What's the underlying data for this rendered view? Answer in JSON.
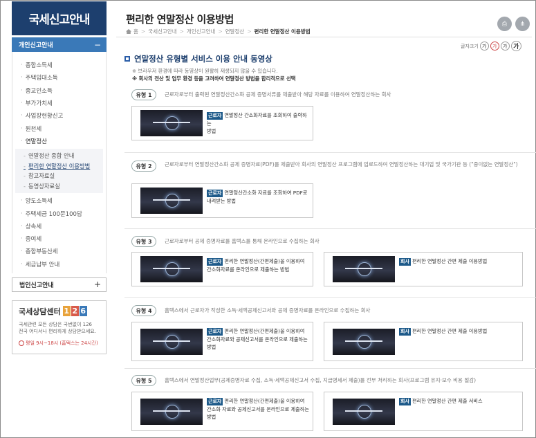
{
  "colors": {
    "brand": "#1d3f6e",
    "section": "#3a79b8",
    "tag": "#1d5a8a",
    "accent_red": "#c44"
  },
  "sidebar": {
    "title": "국세신고안내",
    "section_label": "개인신고안내",
    "section_toggle": "−",
    "items": [
      {
        "label": "종합소득세"
      },
      {
        "label": "주택임대소득"
      },
      {
        "label": "종교인소득"
      },
      {
        "label": "부가가치세"
      },
      {
        "label": "사업장현황신고"
      },
      {
        "label": "원천세"
      },
      {
        "label": "연말정산"
      }
    ],
    "sub_items": [
      {
        "label": "연말정산 종합 안내"
      },
      {
        "label": "편리한 연말정산 이용방법"
      },
      {
        "label": "참고자료실"
      },
      {
        "label": "동영상자료실"
      }
    ],
    "items_after": [
      {
        "label": "양도소득세"
      },
      {
        "label": "주택세금 100문100답"
      },
      {
        "label": "상속세"
      },
      {
        "label": "증여세"
      },
      {
        "label": "종합부동산세"
      },
      {
        "label": "세금납부 안내"
      }
    ],
    "corp_label": "법인신고안내",
    "corp_toggle": "+",
    "counsel": {
      "title": "국세상담센터",
      "digits": [
        "1",
        "2",
        "6"
      ],
      "digit_colors": [
        "#e8a23a",
        "#d85b4a",
        "#3a79b8"
      ],
      "desc1": "국세관련 모든 상담은 국번없이 126",
      "desc2": "전국 어디서나 편리하게 상담받으세요.",
      "time": "평일 9시~18시 (홈택스는 24시간)"
    }
  },
  "header": {
    "title": "편리한 연말정산 이용방법",
    "breadcrumb": [
      "국세신고안내",
      "개인신고안내",
      "연말정산",
      "편리한 연말정산 이용방법"
    ],
    "font_size_label": "글자크기",
    "font_buttons": [
      "가",
      "가",
      "가",
      "가"
    ]
  },
  "section": {
    "title": "연말정산 유형별 서비스 이용 안내 동영상",
    "note1": "※ 브라우저 환경에 따라 동영상이 원활히 재생되지 않을 수 있습니다.",
    "note2": "※ 회사의 전산 및 업무 환경 등을 고려하여 연말정산 방법을 합리적으로 선택"
  },
  "types": [
    {
      "label": "유형 1",
      "desc": "근로자로부터 출력된 연말정산간소화 공제 증명서류를 제출받아 해당 자료를 이용하여 연말정산하는 회사",
      "cards": [
        {
          "tag": "근로자",
          "line1": "연말정산 간소화자료를 조회하여 출력하는",
          "line2": "방법"
        }
      ]
    },
    {
      "label": "유형 2",
      "desc": "근로자로부터 연말정산간소화 공제 증명자료(PDF)를 제출받아 회사의 연말정산 프로그램에 업로드하여 연말정산하는 대기업 및 국가기관 등 (\"중이없는 연말정산\")",
      "cards": [
        {
          "tag": "근로자",
          "line1": "연말정산간소화 자료를 조회하여 PDF로",
          "line2": "내려받는 방법"
        }
      ]
    },
    {
      "label": "유형 3",
      "desc": "근로자로부터 공제 증명자료를 홈택스를 통해 온라인으로 수집하는 회사",
      "cards": [
        {
          "tag": "근로자",
          "line1": "편리한 연말정산(간편제출)을 이용하여",
          "line2": "간소화자료를 온라인으로 제출하는 방법"
        },
        {
          "tag": "회사",
          "line1": "편리한 연말정산 간편 제출 이용방법",
          "line2": ""
        }
      ]
    },
    {
      "label": "유형 4",
      "desc": "홈택스에서 근로자가 작성한 소득·세액공제신고서와 공제 증명자료를 온라인으로 수집하는 회사",
      "cards": [
        {
          "tag": "근로자",
          "line1": "편리한 연말정산(간편제출)을 이용하여",
          "line2": "간소화자료와 공제신고서를 온라인으로 제출하는 방법"
        },
        {
          "tag": "회사",
          "line1": "편리한 연말정산 간편 제출 이용방법",
          "line2": ""
        }
      ]
    },
    {
      "label": "유형 5",
      "desc": "홈택스에서 연말정산업무(공제증명자료 수집, 소득·세액공제신고서 수집, 지급명세서 제출)를 전부 처리하는 회사(프로그램 유지·보수 비용 절감)",
      "cards": [
        {
          "tag": "근로자",
          "line1": "편리한 연말정산(간편제출)을 이용하여",
          "line2": "간소화 자료와 공제신고서를 온라인으로 제출하는 방법"
        },
        {
          "tag": "회사",
          "line1": "편리한 연말정산 간편 제출 서비스",
          "line2": ""
        }
      ]
    }
  ]
}
